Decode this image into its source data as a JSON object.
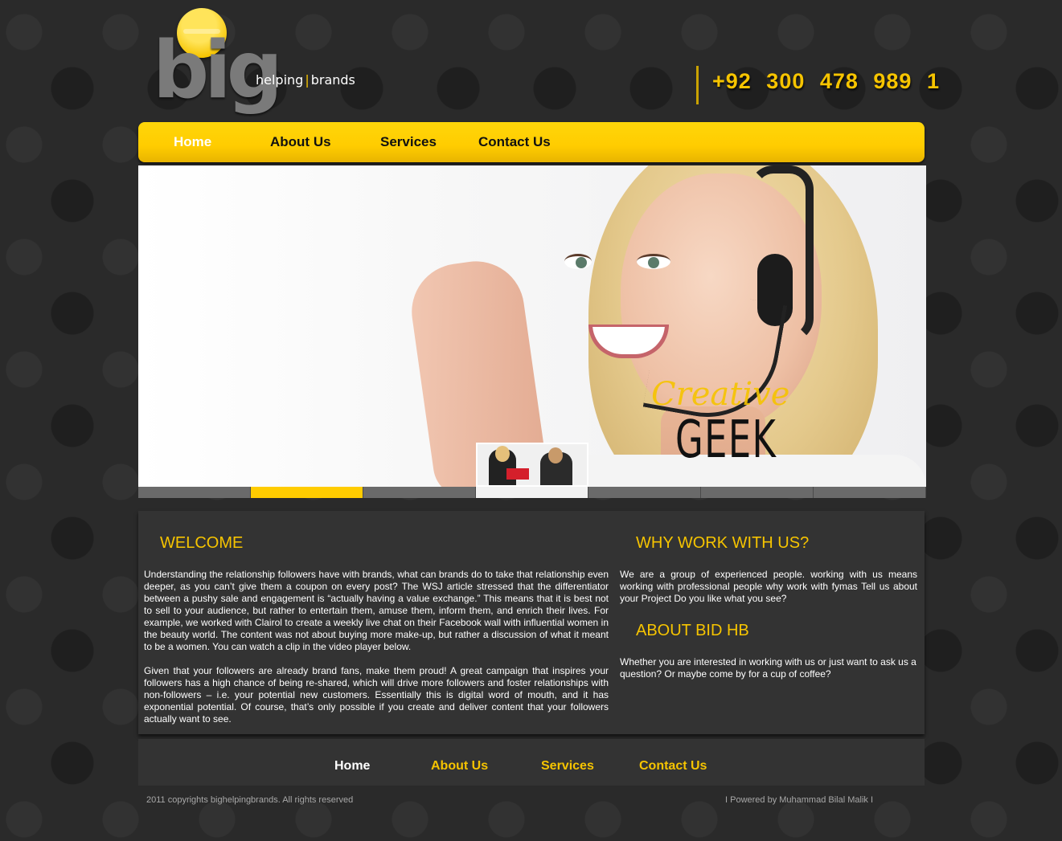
{
  "logo": {
    "word": "big",
    "tagline_left": "helping",
    "tagline_sep": "|",
    "tagline_right": "brands"
  },
  "phone": "+92 300 478 989 1",
  "top_nav": [
    {
      "label": "Home",
      "active": true
    },
    {
      "label": "About Us",
      "active": false
    },
    {
      "label": "Services",
      "active": false
    },
    {
      "label": "Contact Us",
      "active": false
    }
  ],
  "hero": {
    "line1": "Creative",
    "line2": "GEEK"
  },
  "slider_tabs": 7,
  "welcome": {
    "title": "WELCOME",
    "p1": "Understanding the relationship followers have with brands, what can brands do to take that relationship even deeper, as you can’t give them a coupon on every post?  The WSJ article stressed that the differentiator between a pushy sale and engagement is “actually having a value exchange.” This means that it is best not to sell to your audience, but rather to entertain them, amuse them, inform them, and enrich their lives. For example, we worked with Clairol to create a weekly live chat on their Facebook wall with influential women in the beauty world. The content was not about buying more make-up, but rather a discussion of what it meant to be a women. You can watch a clip in the video player below.",
    "p2": "Given that your followers are already brand fans, make them proud!  A great campaign that inspires your followers has a high chance of being re-shared, which will drive more followers and foster relationships with non-followers – i.e. your potential new customers. Essentially this is digital word of mouth, and it has exponential potential.  Of course, that’s only possible if you create and deliver content that your followers actually want to see."
  },
  "why": {
    "title": "WHY WORK WITH US?",
    "text": "We are a group of experienced people. working with us means working with professional people why work with fymas Tell us about your Project Do you like what you see?"
  },
  "about": {
    "title": "ABOUT BID HB",
    "text": "Whether you are interested in working with us or just want to ask us a question? Or maybe come by for a cup of coffee?"
  },
  "bottom_nav": [
    {
      "label": "Home",
      "active": true
    },
    {
      "label": "About Us",
      "active": false
    },
    {
      "label": "Services",
      "active": false
    },
    {
      "label": "Contact Us",
      "active": false
    }
  ],
  "footer": {
    "copyright": "2011 copyrights bighelpingbrands. All rights reserved",
    "powered": "I Powered by Muhammad Bilal Malik I"
  },
  "colors": {
    "accent": "#ffcc00",
    "background": "#2a2a2a",
    "panel": "#333333"
  }
}
